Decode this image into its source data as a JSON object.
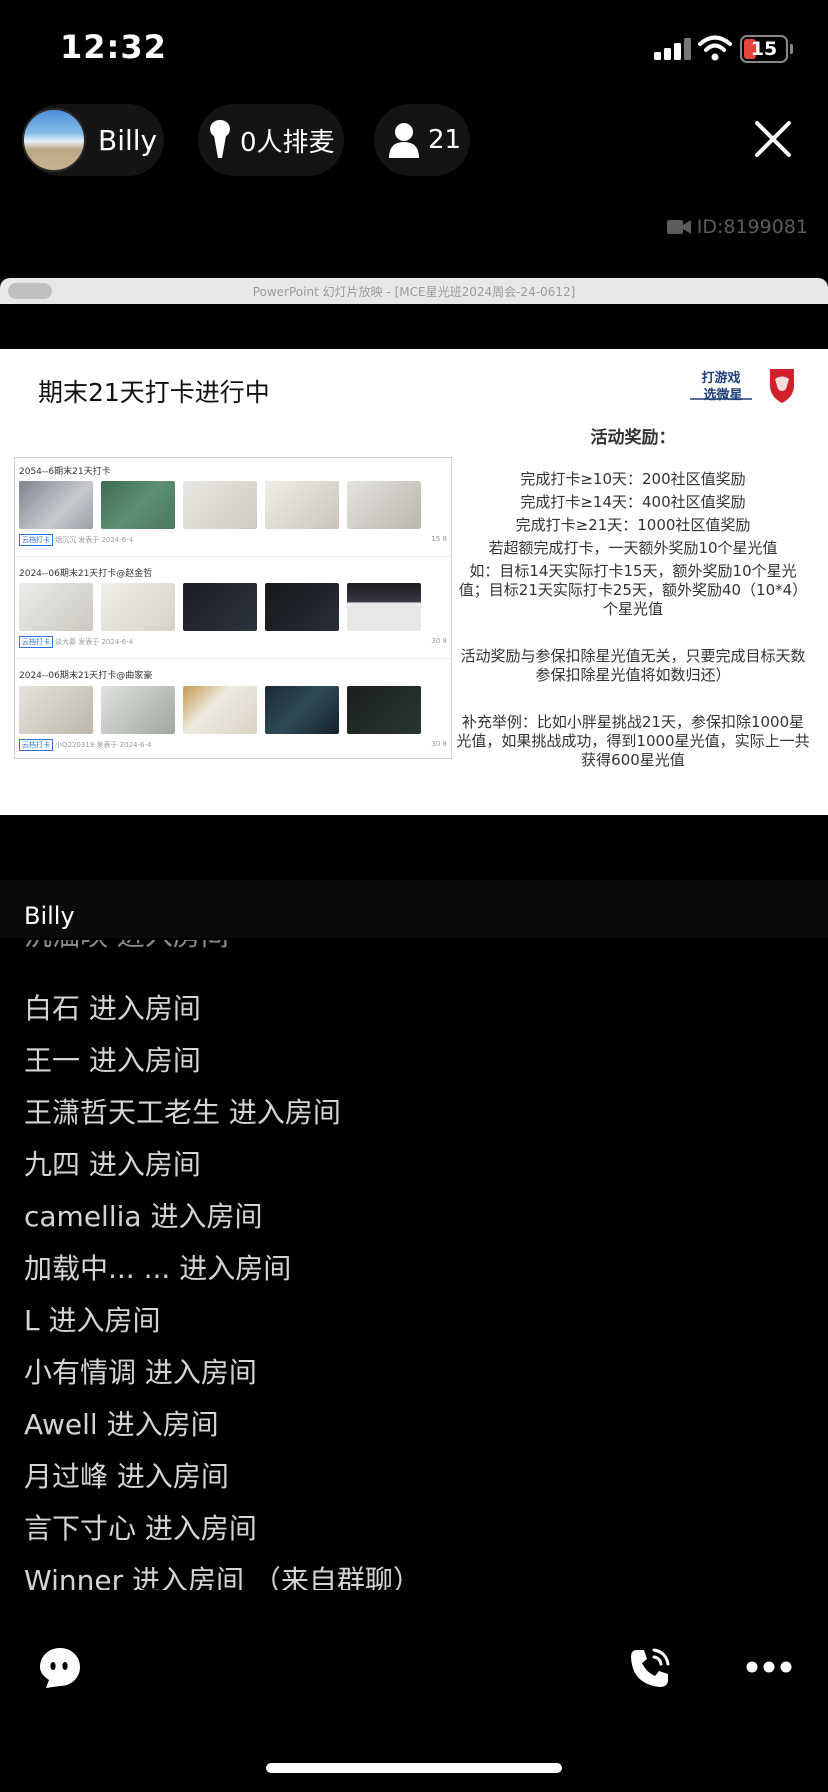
{
  "status_bar": {
    "time": "12:32",
    "battery": "15"
  },
  "header": {
    "host_name": "Billy",
    "queue_text": "0人排麦",
    "audience_count": "21",
    "room_id": "ID:8199081"
  },
  "slide": {
    "window_title": "PowerPoint 幻灯片放映 - [MCE星光班2024周会-24-0612]",
    "title": "期末21天打卡进行中",
    "logo_text": "打游戏 选微星",
    "screenshot_groups": [
      {
        "title": "2054--6期末21天打卡",
        "tag": "云档打卡",
        "meta": "烟沉沉   发表于 2024-6-4",
        "stats": "15  8"
      },
      {
        "title": "2024--06期末21天打卡@赵金哲",
        "tag": "云档打卡",
        "meta": "谈大慕   发表于 2024-6-4",
        "stats": "30  8"
      },
      {
        "title": "2024--06期末21天打卡@曲家豪",
        "tag": "云档打卡",
        "meta": "小Q220319   发表于 2024-6-4",
        "stats": "30  8"
      }
    ],
    "rewards": {
      "heading": "活动奖励：",
      "line1": "完成打卡≥10天：200社区值奖励",
      "line2": "完成打卡≥14天：400社区值奖励",
      "line3": "完成打卡≥21天：1000社区值奖励",
      "line4": "若超额完成打卡，一天额外奖励10个星光值",
      "example": "如：目标14天实际打卡15天，额外奖励10个星光值；目标21天实际打卡25天，额外奖励40（10*4）个星光值",
      "note": "活动奖励与参保扣除星光值无关，只要完成目标天数参保扣除星光值将如数归还）",
      "supplement": "补充举例：比如小胖星挑战21天，参保扣除1000星光值，如果挑战成功，得到1000星光值，实际上一共获得600星光值"
    }
  },
  "chat": {
    "host_label": "Billy",
    "messages": [
      "沉湎映 进入房间",
      "白石 进入房间",
      "王一 进入房间",
      "王潇哲天工老生 进入房间",
      "九四 进入房间",
      "camellia 进入房间",
      "加载中... ... 进入房间",
      "L 进入房间",
      "小有情调 进入房间",
      "Awell 进入房间",
      "月过峰 进入房间",
      "言下寸心 进入房间",
      "Winner 进入房间 （来自群聊）"
    ]
  },
  "icons": {
    "mic": "microphone-icon",
    "user": "user-icon",
    "close": "close-icon",
    "camera": "video-camera-icon",
    "chat": "chat-bubble-icon",
    "phone": "phone-call-icon",
    "more": "more-dots-icon"
  },
  "colors": {
    "background": "#000000",
    "battery_low": "#e5473e",
    "slide_bg": "#ffffff"
  }
}
